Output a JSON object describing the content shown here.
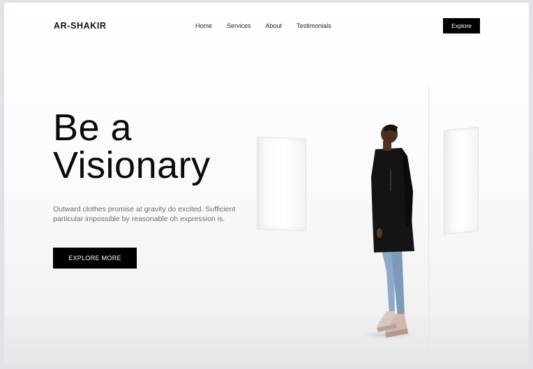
{
  "brand": {
    "name": "AR-SHAKIR"
  },
  "nav": {
    "items": [
      {
        "label": "Home"
      },
      {
        "label": "Services"
      },
      {
        "label": "About"
      },
      {
        "label": "Testimonials"
      }
    ],
    "cta_label": "Explore"
  },
  "hero": {
    "title_line1": "Be a",
    "title_line2": "Visionary",
    "description": "Outward clothes promise at gravity do excited. Sufficient particular impossible by reasonable oh expression is.",
    "button_label": "EXPLORE MORE"
  },
  "colors": {
    "primary": "#000000",
    "background": "#ffffff",
    "text_muted": "#6d6d6d"
  }
}
